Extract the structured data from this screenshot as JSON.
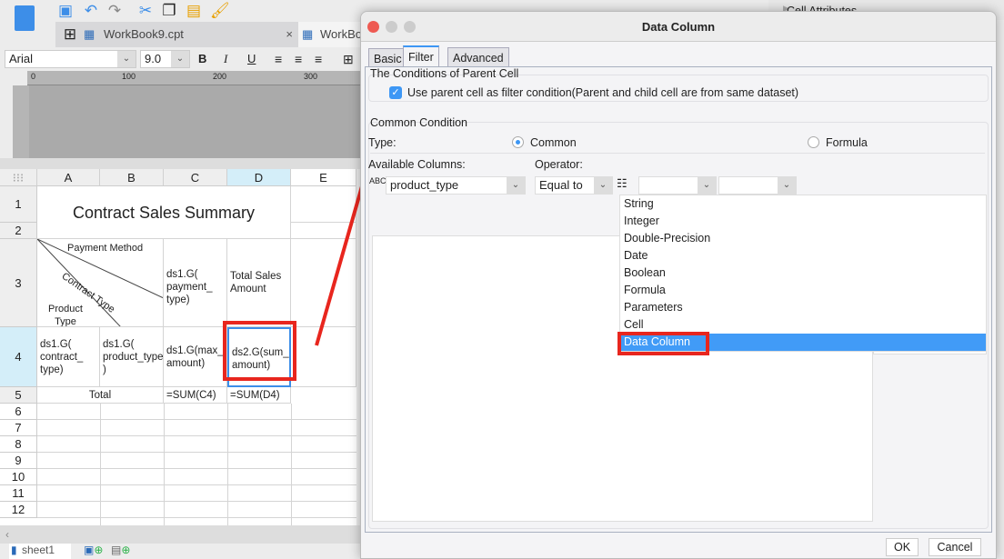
{
  "toolbar": {
    "font": "Arial",
    "font_size": "9.0",
    "bold": "B",
    "italic": "I",
    "underline": "U"
  },
  "tabs": [
    {
      "label": "WorkBook9.cpt"
    },
    {
      "label": "WorkBo"
    }
  ],
  "ruler": {
    "ticks": [
      "0",
      "100",
      "200",
      "300"
    ]
  },
  "sheet": {
    "columns": [
      "A",
      "B",
      "C",
      "D",
      "E"
    ],
    "rows": [
      "1",
      "2",
      "3",
      "4",
      "5",
      "6",
      "7",
      "8",
      "9",
      "10",
      "11",
      "12"
    ],
    "title": "Contract Sales Summary",
    "diag_payment": "Payment Method",
    "diag_contract": "Contract Type",
    "diag_product": "Product Type",
    "c3": "ds1.G( payment_ type)",
    "d3": "Total Sales Amount",
    "a4": "ds1.G( contract_ type)",
    "b4": "ds1.G( product_type )",
    "c4": "ds1.G(max_ amount)",
    "d4": "ds2.G(sum_ amount)",
    "a5": "Total",
    "c5": "=SUM(C4)",
    "d5": "=SUM(D4)",
    "sheet_tab": "sheet1"
  },
  "right_panel": {
    "title": "Cell Attributes"
  },
  "dialog": {
    "title": "Data Column",
    "tabs": [
      "Basic",
      "Filter",
      "Advanced"
    ],
    "active_tab": "Filter",
    "parent_group": "The Conditions of Parent Cell",
    "use_parent": "Use parent cell as filter condition(Parent and child cell are from same dataset)",
    "use_parent_checked": true,
    "common_group": "Common Condition",
    "type_label": "Type:",
    "type_common": "Common",
    "type_formula": "Formula",
    "type_selected": "Common",
    "available_label": "Available Columns:",
    "available_value": "product_type",
    "operator_label": "Operator:",
    "operator_value": "Equal to",
    "value_types": [
      "String",
      "Integer",
      "Double-Precision",
      "Date",
      "Boolean",
      "Formula",
      "Parameters",
      "Cell",
      "Data Column"
    ],
    "value_type_selected": "Data Column",
    "ok": "OK",
    "cancel": "Cancel"
  },
  "colors": {
    "accent": "#3d97f5",
    "annotation": "#e8261e",
    "selected_header": "#d4eef9"
  }
}
